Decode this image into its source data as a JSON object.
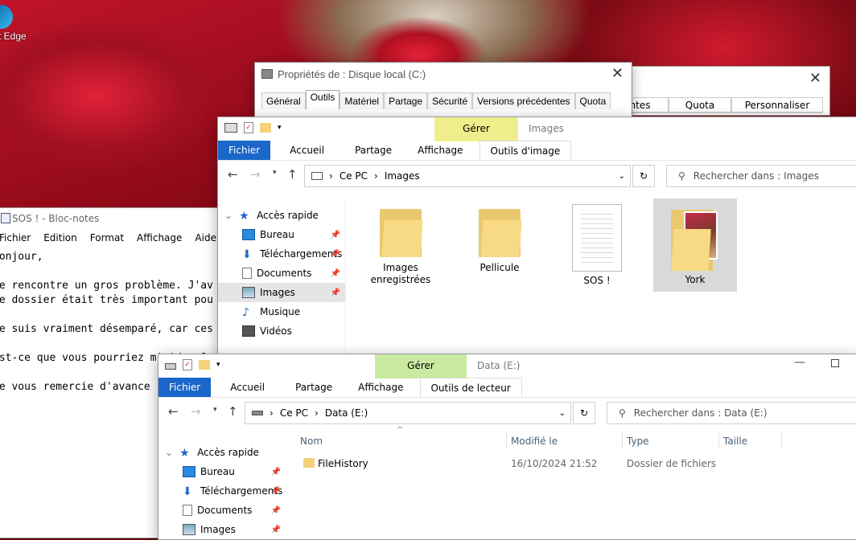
{
  "desktop": {
    "edge_label": "t Edge"
  },
  "properties": {
    "title": "Propriétés de : Disque local (C:)",
    "tabs": [
      "Général",
      "Outils",
      "Matériel",
      "Partage",
      "Sécurité",
      "Versions précédentes",
      "Quota"
    ],
    "selected_tab": "Outils",
    "back_tabs": [
      "ntes",
      "Quota",
      "Personnaliser"
    ]
  },
  "notepad": {
    "title": "SOS ! - Bloc-notes",
    "menu": [
      "Fichier",
      "Edition",
      "Format",
      "Affichage",
      "Aide"
    ],
    "lines": [
      "Bonjour,",
      "",
      "Je rencontre un gros problème. J'av",
      "Ce dossier était très important pou",
      "",
      "Je suis vraiment désemparé, car ces",
      "",
      "Est-ce que vous pourriez m'aider ?",
      "",
      "Je vous remercie d'avance"
    ]
  },
  "explorer_images": {
    "title": "Images",
    "context_tab_header": "Gérer",
    "tabs": [
      "Fichier",
      "Accueil",
      "Partage",
      "Affichage",
      "Outils d'image"
    ],
    "breadcrumb": [
      "Ce PC",
      "Images"
    ],
    "search_placeholder": "Rechercher dans : Images",
    "nav": [
      {
        "label": "Accès rapide",
        "icon": "star-icon"
      },
      {
        "label": "Bureau",
        "icon": "desktop-icon",
        "pinned": true
      },
      {
        "label": "Téléchargements",
        "icon": "download-icon",
        "pinned": true
      },
      {
        "label": "Documents",
        "icon": "document-icon",
        "pinned": true
      },
      {
        "label": "Images",
        "icon": "pictures-icon",
        "pinned": true,
        "selected": true
      },
      {
        "label": "Musique",
        "icon": "music-icon"
      },
      {
        "label": "Vidéos",
        "icon": "video-icon"
      }
    ],
    "items": [
      {
        "label": "Images enregistrées",
        "type": "folder"
      },
      {
        "label": "Pellicule",
        "type": "folder"
      },
      {
        "label": "SOS !",
        "type": "text-file"
      },
      {
        "label": "York",
        "type": "folder-with-image",
        "selected": true
      }
    ]
  },
  "explorer_data": {
    "title": "Data (E:)",
    "context_tab_header": "Gérer",
    "tabs": [
      "Fichier",
      "Accueil",
      "Partage",
      "Affichage",
      "Outils de lecteur"
    ],
    "breadcrumb": [
      "Ce PC",
      "Data (E:)"
    ],
    "search_placeholder": "Rechercher dans : Data (E:)",
    "columns": [
      "Nom",
      "Modifié le",
      "Type",
      "Taille"
    ],
    "rows": [
      {
        "name": "FileHistory",
        "modified": "16/10/2024 21:52",
        "type": "Dossier de fichiers",
        "size": ""
      }
    ],
    "nav": [
      {
        "label": "Accès rapide",
        "icon": "star-icon"
      },
      {
        "label": "Bureau",
        "icon": "desktop-icon",
        "pinned": true
      },
      {
        "label": "Téléchargements",
        "icon": "download-icon",
        "pinned": true
      },
      {
        "label": "Documents",
        "icon": "document-icon",
        "pinned": true
      },
      {
        "label": "Images",
        "icon": "pictures-icon",
        "pinned": true
      }
    ]
  }
}
